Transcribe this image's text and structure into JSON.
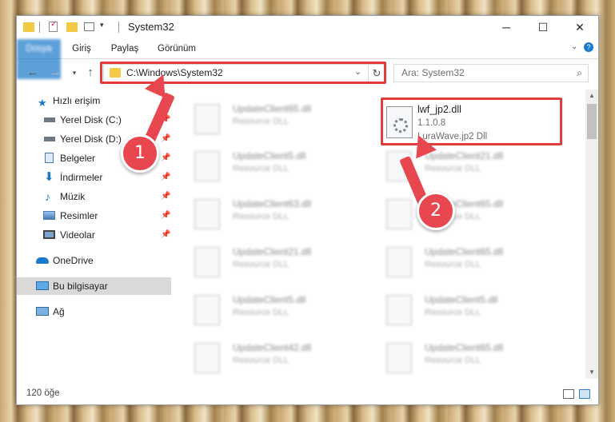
{
  "window": {
    "title": "System32",
    "controls": {
      "minimize": "─",
      "maximize": "☐",
      "close": "✕"
    }
  },
  "ribbon": {
    "tabs": [
      "Dosya",
      "Giriş",
      "Paylaş",
      "Görünüm"
    ]
  },
  "nav": {
    "address": "C:\\Windows\\System32",
    "search_placeholder": "Ara: System32"
  },
  "sidebar": {
    "items": [
      {
        "label": "Hızlı erişim",
        "icon": "star-icon",
        "pinned": false
      },
      {
        "label": "Yerel Disk (C:)",
        "icon": "drive-icon",
        "pinned": true
      },
      {
        "label": "Yerel Disk (D:)",
        "icon": "drive-icon",
        "pinned": true
      },
      {
        "label": "Belgeler",
        "icon": "documents-icon",
        "pinned": true
      },
      {
        "label": "İndirmeler",
        "icon": "download-icon",
        "pinned": true
      },
      {
        "label": "Müzik",
        "icon": "music-icon",
        "pinned": true
      },
      {
        "label": "Resimler",
        "icon": "pictures-icon",
        "pinned": true
      },
      {
        "label": "Videolar",
        "icon": "videos-icon",
        "pinned": true
      },
      {
        "label": "OneDrive",
        "icon": "cloud-icon",
        "pinned": false
      },
      {
        "label": "Bu bilgisayar",
        "icon": "computer-icon",
        "pinned": false,
        "selected": true
      },
      {
        "label": "Ağ",
        "icon": "network-icon",
        "pinned": false
      }
    ]
  },
  "files": {
    "left_column": [
      {
        "name": "UpdateClient65.dll",
        "desc": "Resource DLL"
      },
      {
        "name": "UpdateClient5.dll",
        "desc": "Resource DLL"
      },
      {
        "name": "UpdateClient63.dll",
        "desc": "Resource DLL"
      },
      {
        "name": "UpdateClient21.dll",
        "desc": "Resource DLL"
      },
      {
        "name": "UpdateClient5.dll",
        "desc": "Resource DLL"
      },
      {
        "name": "UpdateClient42.dll",
        "desc": "Resource DLL"
      }
    ],
    "right_column": [
      {
        "name": "UpdateClient21.dll",
        "desc": "Resource DLL"
      },
      {
        "name": "UpdateClient65.dll",
        "desc": "Resource DLL"
      },
      {
        "name": "UpdateClient65.dll",
        "desc": "Resource DLL"
      },
      {
        "name": "UpdateClient5.dll",
        "desc": "Resource DLL"
      },
      {
        "name": "UpdateClient65.dll",
        "desc": "Resource DLL"
      }
    ],
    "highlighted": {
      "name": "lwf_jp2.dll",
      "version": "1.1.0.8",
      "desc": "LuraWave.jp2 Dll"
    }
  },
  "annotations": {
    "badge1": "1",
    "badge2": "2",
    "highlight_color": "#e23b3b"
  },
  "status": {
    "item_count": "120 öğe"
  },
  "colors": {
    "accent": "#1979ca",
    "selected_bg": "#d9d9d9",
    "folder": "#f3c944"
  }
}
